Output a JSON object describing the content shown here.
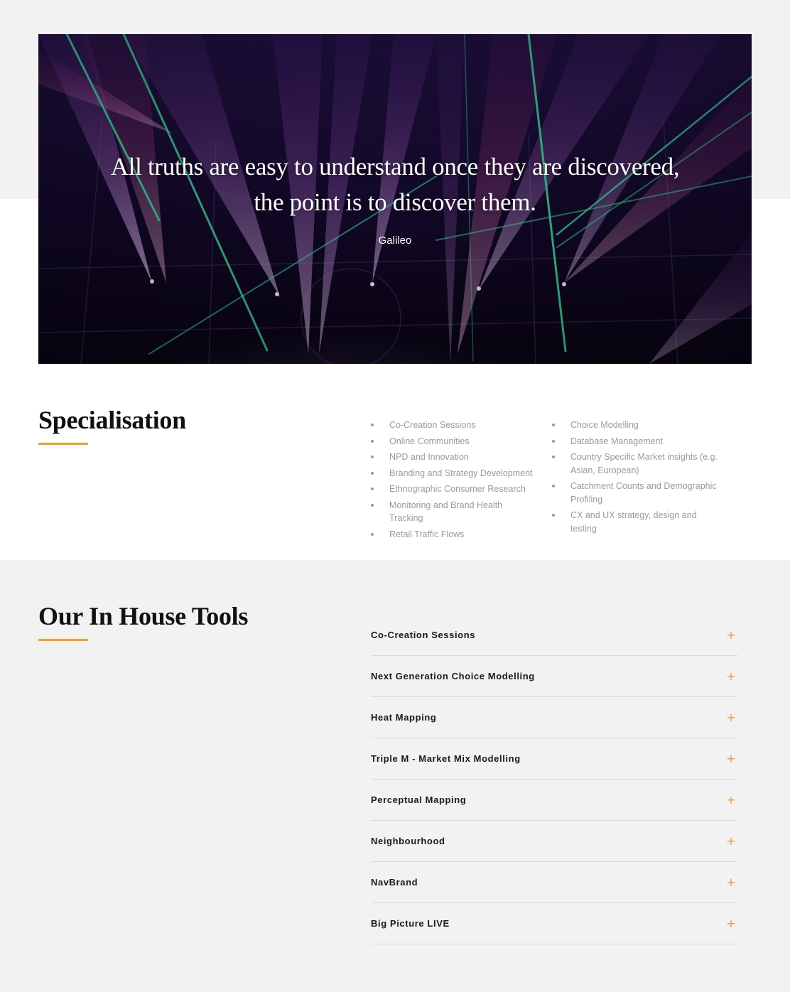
{
  "hero": {
    "quote_line1": "All truths are easy to understand once they are discovered,",
    "quote_line2": "the point is to discover them.",
    "author": "Galileo",
    "image": "stage-laser-light-show"
  },
  "specialisation": {
    "title": "Specialisation",
    "column1": [
      "Co-Creation Sessions",
      "Online Communities",
      "NPD and Innovation",
      "Branding and Strategy Development",
      "Ethnographic Consumer Research",
      "Monitoring and Brand Health Tracking",
      "Retail Traffic Flows"
    ],
    "column2": [
      "Choice Modelling",
      "Database Management",
      "Country Specific Market insights (e.g. Asian, European)",
      "Catchment Counts and Demographic Profiling",
      "CX and UX strategy, design and testing"
    ]
  },
  "tools": {
    "title": "Our In House Tools",
    "expand_icon": "plus-icon",
    "items": [
      "Co-Creation Sessions",
      "Next Generation Choice Modelling",
      "Heat Mapping",
      "Triple M - Market Mix Modelling",
      "Perceptual Mapping",
      "Neighbourhood",
      "NavBrand",
      "Big Picture LIVE"
    ]
  },
  "colors": {
    "accent": "#f29b30",
    "section_bg": "#f2f2f2",
    "heading": "#111111",
    "list_text": "#9a9a9a"
  }
}
